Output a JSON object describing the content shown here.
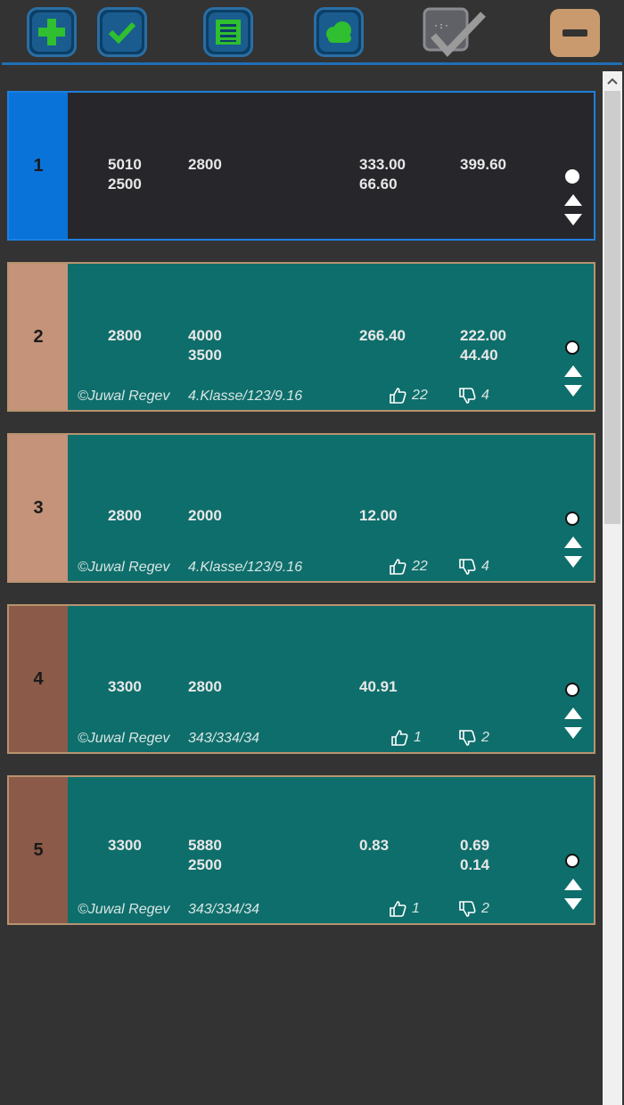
{
  "colors": {
    "accent_blue": "#1e7fe0",
    "card_teal": "#0e6e6b",
    "num_peach": "#c49379",
    "num_brown": "#8b5a48"
  },
  "toolbar": {
    "icons": [
      "plus-icon",
      "check-icon",
      "list-icon",
      "cloud-icon",
      "grade-icon",
      "minimize-icon"
    ]
  },
  "cards": [
    {
      "number": "1",
      "col1": "5010\n2500",
      "col2": "2800",
      "col3": "333.00\n66.60",
      "col4": "399.60",
      "selected": true
    },
    {
      "number": "2",
      "col1": "2800",
      "col2": "4000\n3500",
      "col3": "266.40",
      "col4": "222.00\n44.40",
      "author": "©Juwal Regev",
      "ref": "4.Klasse/123/9.16",
      "likes": "22",
      "dislikes": "4"
    },
    {
      "number": "3",
      "col1": "2800",
      "col2": "2000",
      "col3": "12.00",
      "col4": "",
      "author": "©Juwal Regev",
      "ref": "4.Klasse/123/9.16",
      "likes": "22",
      "dislikes": "4"
    },
    {
      "number": "4",
      "col1": "3300",
      "col2": "2800",
      "col3": "40.91",
      "col4": "",
      "author": "©Juwal Regev",
      "ref": "343/334/34",
      "likes": "1",
      "dislikes": "2"
    },
    {
      "number": "5",
      "col1": "3300",
      "col2": "5880\n2500",
      "col3": "0.83",
      "col4": "0.69\n0.14",
      "author": "©Juwal Regev",
      "ref": "343/334/34",
      "likes": "1",
      "dislikes": "2"
    }
  ]
}
